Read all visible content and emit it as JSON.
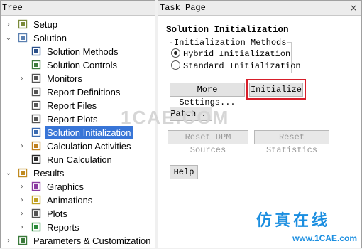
{
  "tree": {
    "header": "Tree",
    "items": [
      {
        "label": "Setup",
        "level": 0,
        "toggle": "›",
        "icon": "setup-icon"
      },
      {
        "label": "Solution",
        "level": 0,
        "toggle": "⌄",
        "icon": "solution-icon"
      },
      {
        "label": "Solution Methods",
        "level": 1,
        "toggle": "",
        "icon": "methods-icon"
      },
      {
        "label": "Solution Controls",
        "level": 1,
        "toggle": "",
        "icon": "controls-icon"
      },
      {
        "label": "Monitors",
        "level": 1,
        "toggle": "›",
        "icon": "monitors-icon"
      },
      {
        "label": "Report Definitions",
        "level": 1,
        "toggle": "",
        "icon": "report-definitions-icon"
      },
      {
        "label": "Report Files",
        "level": 1,
        "toggle": "",
        "icon": "report-files-icon"
      },
      {
        "label": "Report Plots",
        "level": 1,
        "toggle": "",
        "icon": "report-plots-icon"
      },
      {
        "label": "Solution Initialization",
        "level": 1,
        "toggle": "",
        "icon": "initialization-icon",
        "selected": true
      },
      {
        "label": "Calculation Activities",
        "level": 1,
        "toggle": "›",
        "icon": "calculation-activities-icon"
      },
      {
        "label": "Run Calculation",
        "level": 1,
        "toggle": "",
        "icon": "run-calculation-icon"
      },
      {
        "label": "Results",
        "level": 0,
        "toggle": "⌄",
        "icon": "results-icon"
      },
      {
        "label": "Graphics",
        "level": 1,
        "toggle": "›",
        "icon": "graphics-icon"
      },
      {
        "label": "Animations",
        "level": 1,
        "toggle": "›",
        "icon": "animations-icon"
      },
      {
        "label": "Plots",
        "level": 1,
        "toggle": "›",
        "icon": "plots-icon"
      },
      {
        "label": "Reports",
        "level": 1,
        "toggle": "›",
        "icon": "reports-icon"
      },
      {
        "label": "Parameters & Customization",
        "level": 0,
        "toggle": "›",
        "icon": "parameters-icon"
      }
    ]
  },
  "task": {
    "header": "Task Page",
    "close": "×",
    "title": "Solution Initialization",
    "methods_label": "Initialization Methods",
    "methods": [
      {
        "label": "Hybrid  Initialization",
        "selected": true
      },
      {
        "label": "Standard Initialization",
        "selected": false
      }
    ],
    "more_settings": "More Settings...",
    "initialize": "Initialize",
    "patch": "Patch...",
    "reset_dpm": "Reset DPM Sources",
    "reset_stats": "Reset Statistics",
    "help": "Help"
  },
  "watermark": {
    "center": "1CAE.COM",
    "cn": "仿真在线",
    "url": "www.1CAE.com"
  },
  "colors": {
    "selection": "#3875d7",
    "highlight": "#d71e2a",
    "watermark": "#1b8ee0"
  }
}
